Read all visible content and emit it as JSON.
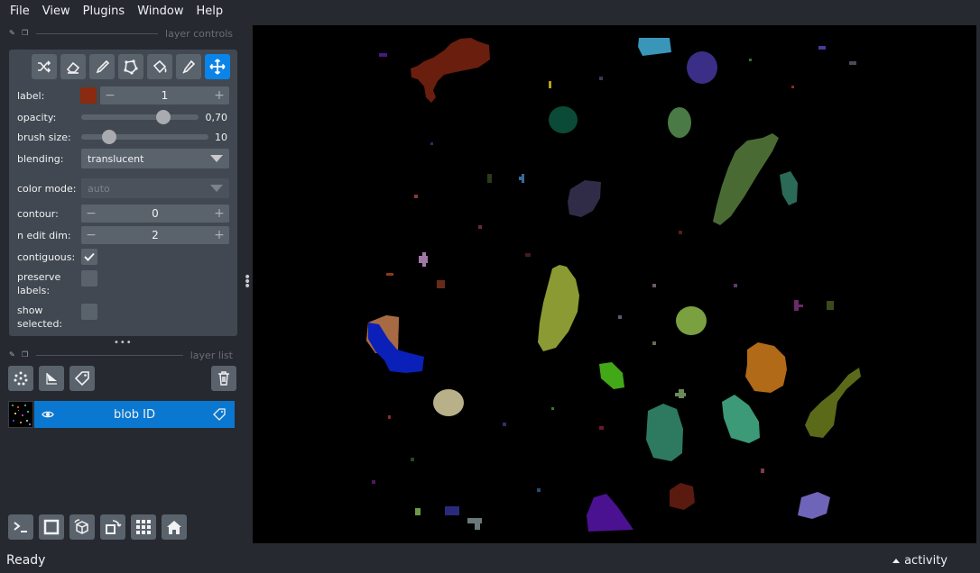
{
  "menu": [
    "File",
    "View",
    "Plugins",
    "Window",
    "Help"
  ],
  "controls_dock": {
    "title": "layer controls"
  },
  "layer_list_dock": {
    "title": "layer list"
  },
  "tools": [
    "shuffle-icon",
    "eraser-icon",
    "paintbrush-icon",
    "polygon-icon",
    "fill-bucket-icon",
    "color-picker-icon",
    "pan-zoom-icon"
  ],
  "active_tool": "pan-zoom-icon",
  "label": {
    "name": "label:",
    "value": "1",
    "color": "#8a2a10"
  },
  "opacity": {
    "name": "opacity:",
    "value": "0,70",
    "fraction": 0.7
  },
  "brush_size": {
    "name": "brush size:",
    "value": "10",
    "fraction": 0.22
  },
  "blending": {
    "name": "blending:",
    "value": "translucent"
  },
  "color_mode": {
    "name": "color mode:",
    "value": "auto"
  },
  "contour": {
    "name": "contour:",
    "value": "0"
  },
  "n_edit_dim": {
    "name": "n edit dim:",
    "value": "2"
  },
  "contiguous": {
    "name": "contiguous:",
    "checked": true
  },
  "preserve_labels": {
    "name_line1": "preserve",
    "name_line2": "labels:",
    "checked": false
  },
  "show_selected": {
    "name_line1": "show",
    "name_line2": "selected:",
    "checked": false
  },
  "layer": {
    "name": "blob ID",
    "visible": true
  },
  "status": {
    "text": "Ready",
    "activity": "activity"
  },
  "accent_color": "#0a78d0"
}
